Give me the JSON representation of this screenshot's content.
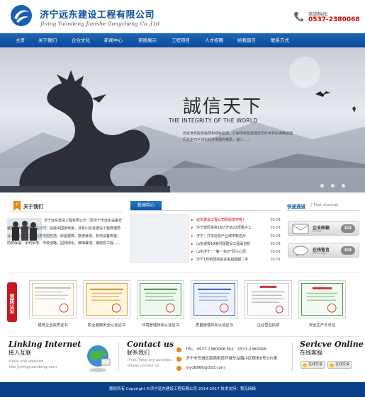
{
  "header": {
    "company_cn": "济宁远东建设工程有限公司",
    "company_en": "Jining Yuandong Jianshe Gongcheng Co.,Ltd",
    "hotline_label": "咨询热线：",
    "hotline_number": "0537-2380068"
  },
  "nav": {
    "items": [
      "主页",
      "关于我们",
      "企业文化",
      "新闻中心",
      "资质展示",
      "工程项目",
      "人才招聘",
      "给我留言",
      "联系方式"
    ]
  },
  "banner": {
    "slogan_cn": "誠信天下",
    "slogan_en": "THE INTEGRITY OF THE WORLD",
    "desc": "改变世界能源格局和绿色能源，打破传统能源理念同时世界的通畅道理历史走向全球化经济发展的格局，减少......"
  },
  "about": {
    "title": "关于我们",
    "text": "济宁远东建设工程有限公司（原济宁市远东设备安装防腐保温有限责任公司）是经由国家审批，具有山东省建设工程管理局认证的企业，主要业务范围包括：房屋建筑、旅游景观、机电设备安装、防腐保温、水利水电、市政道路、园林绿化、玻璃幕墙、钢结构工程......"
  },
  "news": {
    "tab": "新闻中心",
    "items": [
      {
        "title": "远东建设工程公司网站发布啦！",
        "date": "03-01",
        "hot": true
      },
      {
        "title": "济宁城区投资16亿开始22项重点工",
        "date": "03-01",
        "hot": false
      },
      {
        "title": "济宁：打造信息产业城市新名片",
        "date": "03-01",
        "hot": false
      },
      {
        "title": "山东通报18家问题建设工程承包机",
        "date": "03-01",
        "hot": false
      },
      {
        "title": "山东济宁：“第一书记”回火心愿",
        "date": "03-01",
        "hot": false
      },
      {
        "title": "济宁1月新建商品住宅指数超二手",
        "date": "03-01",
        "hot": false
      }
    ]
  },
  "quick": {
    "title": "快速通道",
    "subtitle": "| Fast channel",
    "buttons": [
      {
        "label": "企业邮箱",
        "label_en": "Email",
        "go": "GO",
        "icon": "email-icon"
      },
      {
        "label": "在线留言",
        "label_en": "Message",
        "go": "GO",
        "icon": "message-icon"
      }
    ]
  },
  "certificates": {
    "badge": "资质认证",
    "items": [
      {
        "caption": "建筑企业资质证书"
      },
      {
        "caption": "职业健康安全认证证书"
      },
      {
        "caption": "环境管理体系认证证书"
      },
      {
        "caption": "质量管理体系认证证书"
      },
      {
        "caption": "企业营业执照"
      },
      {
        "caption": "安全生产许可证"
      }
    ]
  },
  "linking": {
    "title": "Linking Internet",
    "cn": "接入互联",
    "desc_line1": "have one website",
    "desc_line2": "like jiningyuandong.com"
  },
  "contact": {
    "title": "Contact us",
    "cn": "联系我们",
    "desc_line1": "If you have any question,",
    "desc_line2": "please contact us",
    "tel": "TEL：0537-2380068    FAX：0537-2380068",
    "address": "济宁市任城区南苑街道环城车站路小区宿舍8号205室",
    "email": "jnyd8866@163.com"
  },
  "service": {
    "title": "Sericve Online",
    "cn": "在线客服",
    "qq1": "在线交谈",
    "qq2": "在线交谈"
  },
  "footer": {
    "copyright": "版权所有 Copyright ©济宁远东建设工程有限公司 2014-2017  技术支持：我无网络"
  },
  "colors": {
    "brand_blue": "#0d4d9c",
    "nav_blue": "#1e66b8",
    "accent_red": "#d40000",
    "footer_blue": "#0b3f86"
  }
}
